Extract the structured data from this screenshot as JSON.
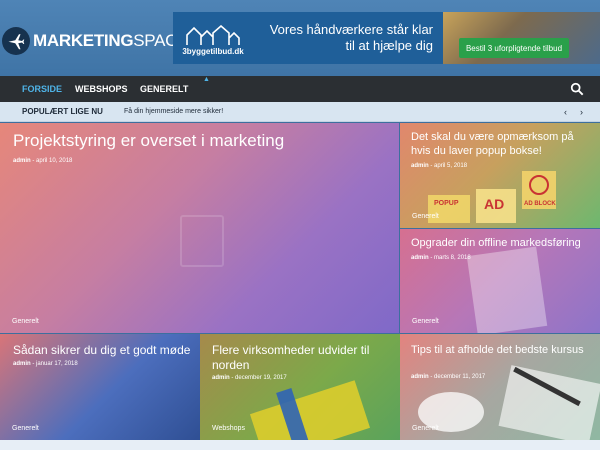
{
  "site": {
    "logo_part1": "MARKETING",
    "logo_part2": "SPACE"
  },
  "banner": {
    "brand": "3byggetilbud.dk",
    "headline_line1": "Vores håndværkere står klar",
    "headline_line2": "til at hjælpe dig",
    "cta": "Bestil 3 uforpligtende tilbud"
  },
  "nav": {
    "items": [
      {
        "label": "FORSIDE",
        "active": true
      },
      {
        "label": "WEBSHOPS",
        "active": false
      },
      {
        "label": "GENERELT",
        "active": false
      }
    ]
  },
  "trending": {
    "title": "POPULÆRT LIGE NU",
    "text": "Få din hjemmeside mere sikker!",
    "prev": "‹",
    "next": "›"
  },
  "posts": [
    {
      "title": "Projektstyring er overset i marketing",
      "author": "admin",
      "date": "april 10, 2018",
      "category": "Generelt"
    },
    {
      "title": "Det skal du være opmærksom på hvis du laver popup bokse!",
      "author": "admin",
      "date": "april 5, 2018",
      "category": "Generelt"
    },
    {
      "title": "Opgrader din offline markedsføring",
      "author": "admin",
      "date": "marts 8, 2018",
      "category": "Generelt"
    },
    {
      "title": "Sådan sikrer du dig et godt møde",
      "author": "admin",
      "date": "januar 17, 2018",
      "category": "Generelt"
    },
    {
      "title": "Flere virksomheder udvider til norden",
      "author": "admin",
      "date": "december 19, 2017",
      "category": "Webshops"
    },
    {
      "title": "Tips til at afholde det bedste kursus",
      "author": "admin",
      "date": "december 11, 2017",
      "category": "Generelt"
    }
  ],
  "ad_image_text": {
    "popup": "POPUP",
    "ad": "AD",
    "adblock": "AD BLOCK"
  },
  "colors": {
    "header_bg": "#4a7fb1",
    "nav_bg": "#2b2f33",
    "nav_active": "#4fb4e8",
    "cta_green": "#2aa04a"
  },
  "icons": {
    "logo": "airplane-icon",
    "search": "search-icon"
  }
}
